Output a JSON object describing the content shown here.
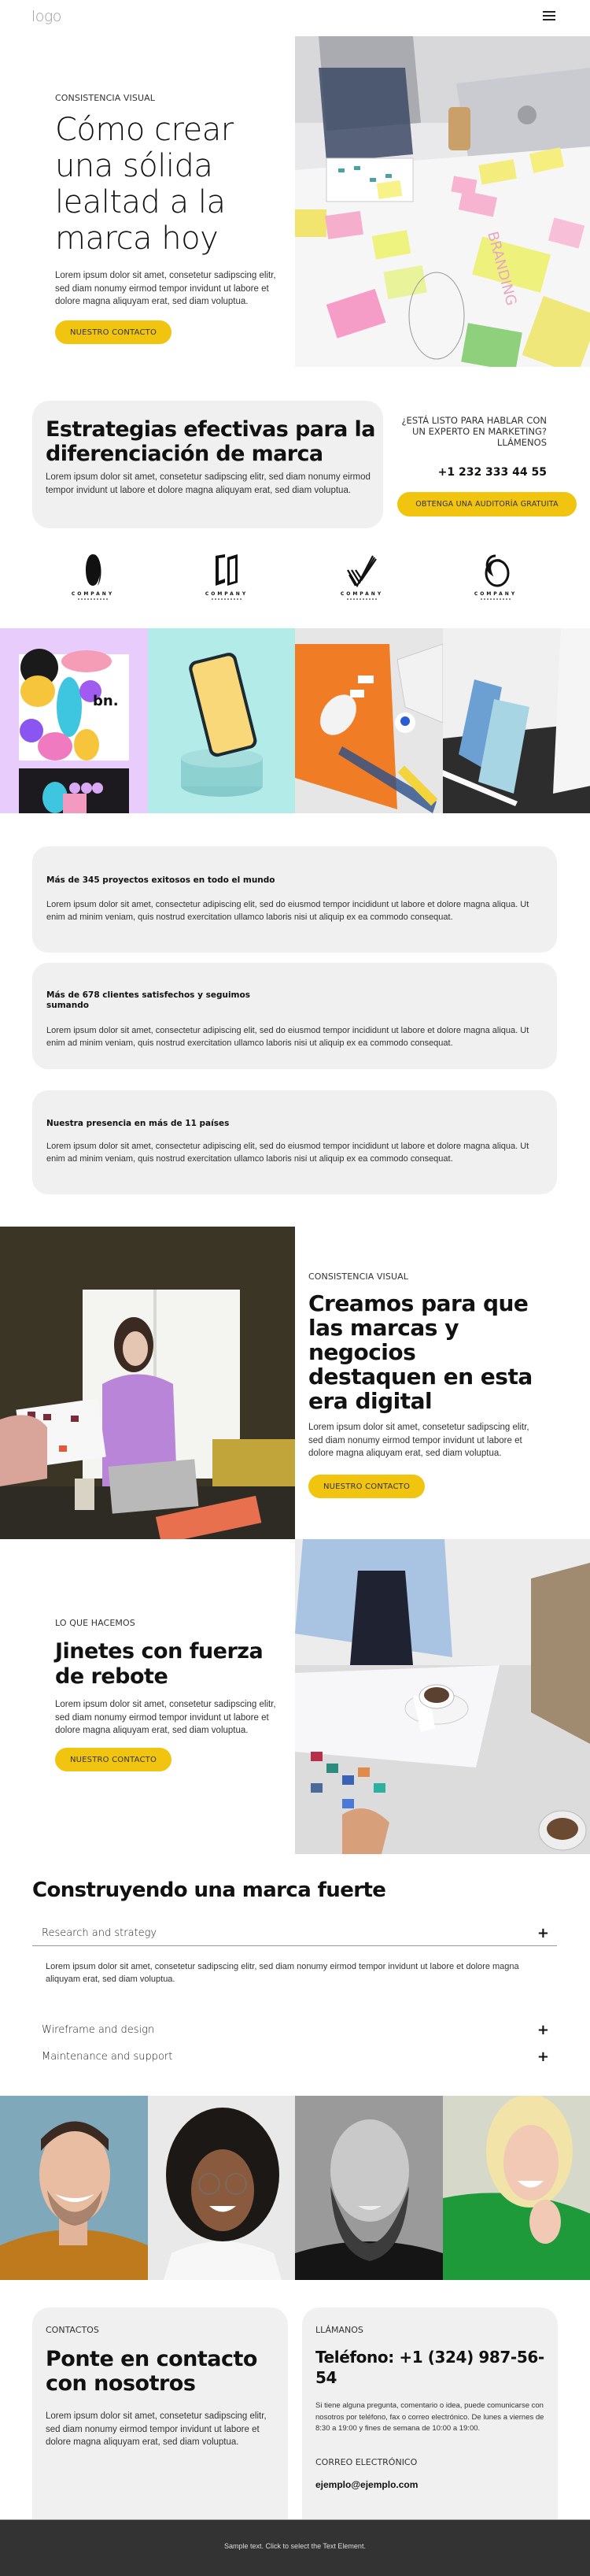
{
  "header": {
    "logo": "logo",
    "menu_icon": "hamburger-menu-icon"
  },
  "hero": {
    "eyebrow": "Consistencia visual",
    "title": "Cómo crear una sólida lealtad a la marca hoy",
    "text": "Lorem ipsum dolor sit amet, consetetur sadipscing elitr, sed diam nonumy eirmod tempor invidunt ut labore et dolore magna aliquyam erat, sed diam voluptua.",
    "button": "Nuestro contacto",
    "image": "team-planning-with-sticky-notes-photo"
  },
  "strategies": {
    "title": "Estrategias efectivas para la diferenciación de marca",
    "text": "Lorem ipsum dolor sit amet, consetetur sadipscing elitr, sed diam nonumy eirmod tempor invidunt ut labore et dolore magna aliquyam erat, sed diam voluptua.",
    "cta_question": "¿Está listo para hablar con un experto en marketing? Llámenos",
    "cta_phone": "+1 232 333 44 55",
    "cta_button": "Obtenga una auditoría gratuita"
  },
  "logos": [
    {
      "name": "COMPANY",
      "icon": "ring-o-logo-icon"
    },
    {
      "name": "COMPANY",
      "icon": "open-book-logo-icon"
    },
    {
      "name": "COMPANY",
      "icon": "stripes-v-logo-icon"
    },
    {
      "name": "COMPANY",
      "icon": "double-circle-logo-icon"
    }
  ],
  "gallery": [
    {
      "image": "business-cards-mockup"
    },
    {
      "image": "phone-mockup-on-pedestal"
    },
    {
      "image": "desk-stationery-flatlay"
    },
    {
      "image": "blue-cards-mockup"
    }
  ],
  "stats": [
    {
      "title": "Más de 345 proyectos exitosos en todo el mundo",
      "text": "Lorem ipsum dolor sit amet, consectetur adipiscing elit, sed do eiusmod tempor incididunt ut labore et dolore magna aliqua. Ut enim ad minim veniam, quis nostrud exercitation ullamco laboris nisi ut aliquip ex ea commodo consequat."
    },
    {
      "title": "Más de 678 clientes satisfechos y seguimos sumando",
      "text": "Lorem ipsum dolor sit amet, consectetur adipiscing elit, sed do eiusmod tempor incididunt ut labore et dolore magna aliqua. Ut enim ad minim veniam, quis nostrud exercitation ullamco laboris nisi ut aliquip ex ea commodo consequat."
    },
    {
      "title": "Nuestra presencia en más de 11 países",
      "text": "Lorem ipsum dolor sit amet, consectetur adipiscing elit, sed do eiusmod tempor incididunt ut labore et dolore magna aliqua. Ut enim ad minim veniam, quis nostrud exercitation ullamco laboris nisi ut aliquip ex ea commodo consequat."
    }
  ],
  "feature1": {
    "eyebrow": "Consistencia visual",
    "title": "Creamos para que las marcas y negocios destaquen en esta era digital",
    "text": "Lorem ipsum dolor sit amet, consetetur sadipscing elitr, sed diam nonumy eirmod tempor invidunt ut labore et dolore magna aliquyam erat, sed diam voluptua.",
    "button": "Nuestro contacto",
    "image": "woman-presenting-color-swatches"
  },
  "feature2": {
    "eyebrow": "Lo que hacemos",
    "title": "Jinetes con fuerza de rebote",
    "text": "Lorem ipsum dolor sit amet, consetetur sadipscing elitr, sed diam nonumy eirmod tempor invidunt ut labore et dolore magna aliquyam erat, sed diam voluptua.",
    "button": "Nuestro contacto",
    "image": "meeting-with-papers-and-coffee"
  },
  "accordion": {
    "title": "Construyendo una marca fuerte",
    "items": [
      {
        "label": "Research and strategy",
        "icon": "plus-icon",
        "open": true,
        "body": "Lorem ipsum dolor sit amet, consetetur sadipscing elitr, sed diam nonumy eirmod tempor invidunt ut labore et dolore magna aliquyam erat, sed diam voluptua."
      },
      {
        "label": "Wireframe and design",
        "icon": "plus-icon",
        "open": false
      },
      {
        "label": "Maintenance and support",
        "icon": "plus-icon",
        "open": false
      }
    ]
  },
  "team": [
    {
      "image": "portrait-man-orange-shirt"
    },
    {
      "image": "portrait-woman-curly-hair-glasses"
    },
    {
      "image": "portrait-bearded-man-bw"
    },
    {
      "image": "portrait-blonde-woman-green-sweater"
    }
  ],
  "contact": {
    "left": {
      "eyebrow": "Contactos",
      "title": "Ponte en contacto con nosotros",
      "text": "Lorem ipsum dolor sit amet, consetetur sadipscing elitr, sed diam nonumy eirmod tempor invidunt ut labore et dolore magna aliquyam erat, sed diam voluptua."
    },
    "right": {
      "eyebrow": "Llámanos",
      "phone": "Teléfono: +1 (324) 987-56-54",
      "info": "Si tiene alguna pregunta, comentario o idea, puede comunicarse con nosotros por teléfono, fax o correo electrónico. De lunes a viernes de 8:30 a 19:00 y fines de semana de 10:00 a 19:00.",
      "email_label": "Correo electrónico",
      "email": "ejemplo@ejemplo.com"
    }
  },
  "footer": {
    "text": "Sample text. Click to select the Text Element."
  },
  "colors": {
    "accent": "#f1c40f",
    "card_bg": "#f0f0f0",
    "footer_bg": "#333333"
  }
}
